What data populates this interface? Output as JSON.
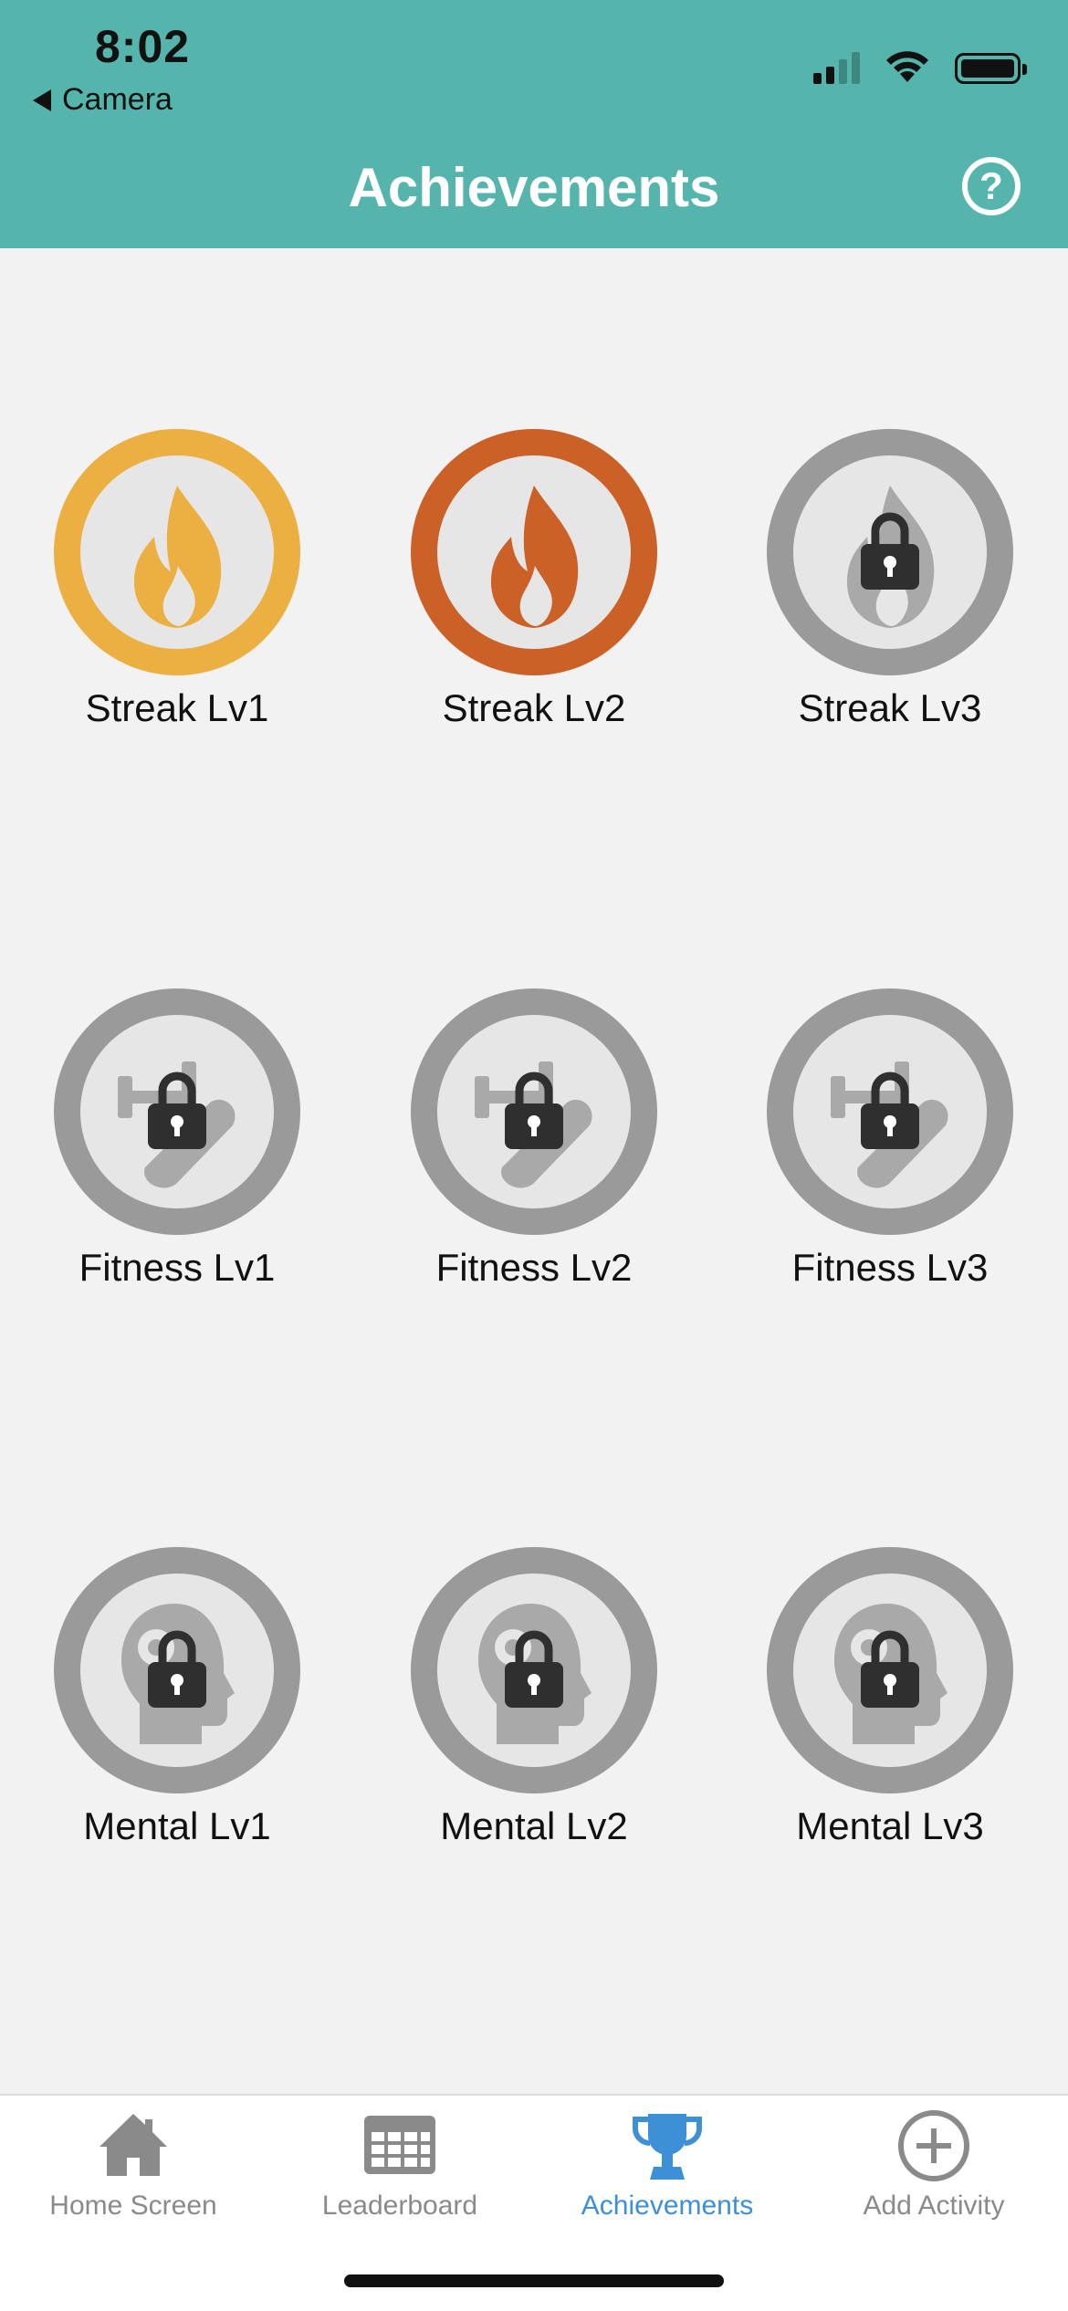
{
  "status_bar": {
    "time": "8:02",
    "back_app": "Camera"
  },
  "header": {
    "title": "Achievements",
    "help_symbol": "?",
    "background_color": "#55b5ad"
  },
  "achievements": [
    {
      "label": "Streak Lv1",
      "category": "streak",
      "unlocked": true,
      "ring_color": "#ecb042",
      "icon": "flame-icon"
    },
    {
      "label": "Streak Lv2",
      "category": "streak",
      "unlocked": true,
      "ring_color": "#cc6127",
      "icon": "flame-icon"
    },
    {
      "label": "Streak Lv3",
      "category": "streak",
      "unlocked": false,
      "ring_color": "#9a9a9a",
      "icon": "flame-icon"
    },
    {
      "label": "Fitness Lv1",
      "category": "fitness",
      "unlocked": false,
      "ring_color": "#9a9a9a",
      "icon": "fitness-icon"
    },
    {
      "label": "Fitness Lv2",
      "category": "fitness",
      "unlocked": false,
      "ring_color": "#9a9a9a",
      "icon": "fitness-icon"
    },
    {
      "label": "Fitness Lv3",
      "category": "fitness",
      "unlocked": false,
      "ring_color": "#9a9a9a",
      "icon": "fitness-icon"
    },
    {
      "label": "Mental Lv1",
      "category": "mental",
      "unlocked": false,
      "ring_color": "#9a9a9a",
      "icon": "brain-head-icon"
    },
    {
      "label": "Mental Lv2",
      "category": "mental",
      "unlocked": false,
      "ring_color": "#9a9a9a",
      "icon": "brain-head-icon"
    },
    {
      "label": "Mental Lv3",
      "category": "mental",
      "unlocked": false,
      "ring_color": "#9a9a9a",
      "icon": "brain-head-icon"
    }
  ],
  "tabs": [
    {
      "label": "Home Screen",
      "icon": "home-icon",
      "active": false
    },
    {
      "label": "Leaderboard",
      "icon": "table-grid-icon",
      "active": false
    },
    {
      "label": "Achievements",
      "icon": "trophy-icon",
      "active": true
    },
    {
      "label": "Add Activity",
      "icon": "plus-circle-icon",
      "active": false
    }
  ],
  "colors": {
    "accent_teal": "#55b5ad",
    "active_tab": "#3d8fd6",
    "inactive_tab": "#8a8a8a",
    "locked_gray": "#9a9a9a"
  }
}
